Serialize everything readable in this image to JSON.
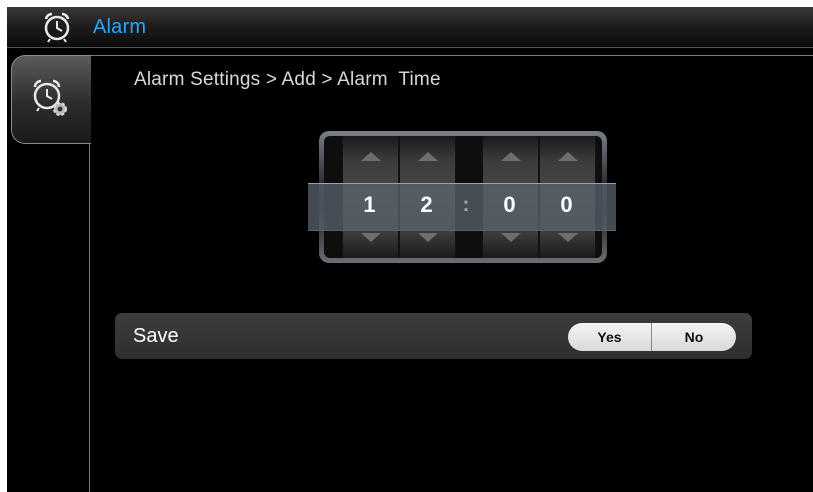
{
  "app": {
    "title": "Alarm",
    "icon": "alarm-clock-icon"
  },
  "sidebar": {
    "tab_icon": "alarm-settings-icon"
  },
  "breadcrumb": "Alarm Settings > Add > Alarm  Time",
  "time_picker": {
    "digits": [
      "1",
      "2",
      "0",
      "0"
    ],
    "separator": ":"
  },
  "save_row": {
    "label": "Save",
    "yes_label": "Yes",
    "no_label": "No"
  },
  "colors": {
    "title_accent": "#2ba6ff",
    "background": "#000000"
  }
}
